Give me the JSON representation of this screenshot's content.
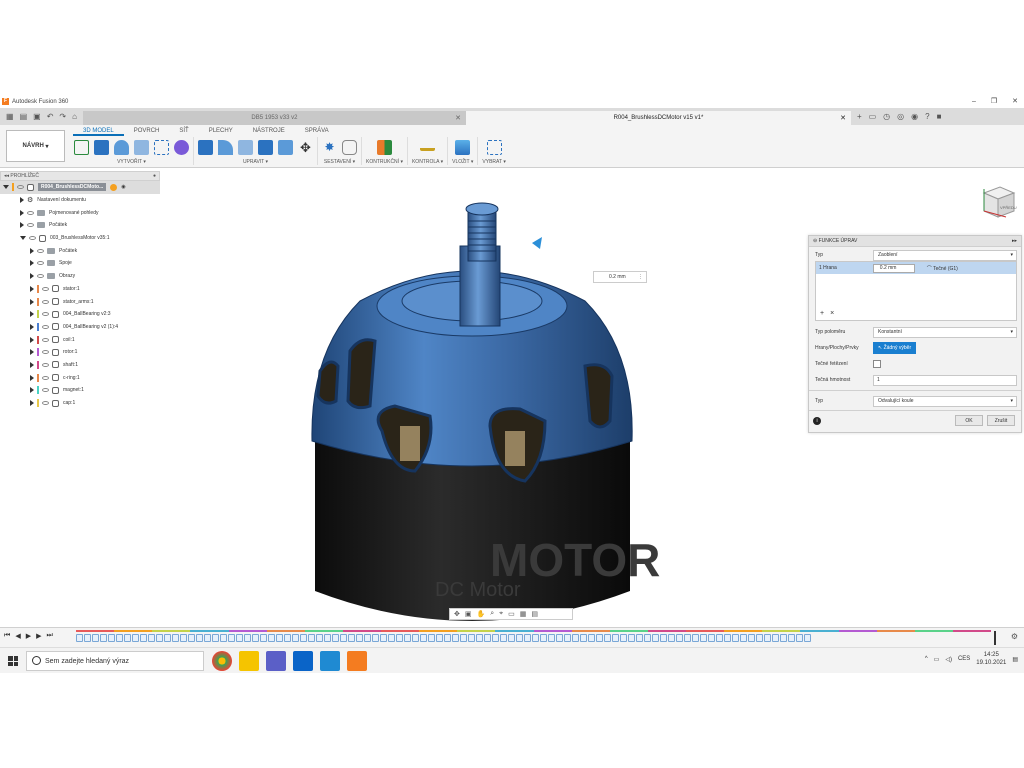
{
  "window": {
    "title": "Autodesk Fusion 360"
  },
  "tabs": [
    {
      "label": "DB5 1953 v33 v2",
      "active": false
    },
    {
      "label": "R004_BrushlessDCMotor v15 v1*",
      "active": true
    }
  ],
  "toolbar": {
    "nav_button": "NÁVRH",
    "workspace_tabs": [
      "3D MODEL",
      "POVRCH",
      "SÍŤ",
      "PLECHY",
      "NÁSTROJE",
      "SPRÁVA"
    ],
    "groups": [
      {
        "label": "VYTVOŘIT ▾"
      },
      {
        "label": "UPRAVIT ▾"
      },
      {
        "label": "SESTAVENÍ ▾"
      },
      {
        "label": "KONTRUKČNÍ ▾"
      },
      {
        "label": "KONTROLA ▾"
      },
      {
        "label": "VLOŽIT ▾"
      },
      {
        "label": "VYBRAT ▾"
      }
    ]
  },
  "browser": {
    "title": "PROHLÍŽEČ",
    "root": "R004_BrushlessDCMoto...",
    "items": [
      {
        "label": "Nastavení dokumentu",
        "level": 1,
        "icon": "gear-icon"
      },
      {
        "label": "Pojmenované pohledy",
        "level": 1,
        "icon": "folder-icon"
      },
      {
        "label": "Počátek",
        "level": 1,
        "icon": "folder-icon"
      },
      {
        "label": "003_BrushlessMotor v35:1",
        "level": 1,
        "icon": "component-icon",
        "expanded": true
      },
      {
        "label": "Počátek",
        "level": 2,
        "icon": "folder-icon"
      },
      {
        "label": "Spoje",
        "level": 2,
        "icon": "folder-icon"
      },
      {
        "label": "Obrazy",
        "level": 2,
        "icon": "folder-icon"
      },
      {
        "label": "stator:1",
        "level": 2,
        "icon": "component-icon",
        "color": "#e8884a"
      },
      {
        "label": "stator_arms:1",
        "level": 2,
        "icon": "component-icon",
        "color": "#e8884a"
      },
      {
        "label": "004_BallBearing v2:3",
        "level": 2,
        "icon": "component-icon",
        "color": "#c4d24a"
      },
      {
        "label": "004_BallBearing v2 (1):4",
        "level": 2,
        "icon": "component-icon",
        "color": "#4a7fd2"
      },
      {
        "label": "coil:1",
        "level": 2,
        "icon": "component-icon",
        "color": "#d24a4a"
      },
      {
        "label": "rotor:1",
        "level": 2,
        "icon": "component-icon",
        "color": "#b45ad2"
      },
      {
        "label": "shaft:1",
        "level": 2,
        "icon": "component-icon",
        "color": "#d24a8a"
      },
      {
        "label": "c-ring:1",
        "level": 2,
        "icon": "component-icon",
        "color": "#e8884a"
      },
      {
        "label": "magnet:1",
        "level": 2,
        "icon": "component-icon",
        "color": "#4ad2c4"
      },
      {
        "label": "cap:1",
        "level": 2,
        "icon": "component-icon",
        "color": "#e8c84a"
      }
    ]
  },
  "viewport": {
    "dimension_value": "0.2 mm",
    "viewcube_label": "VPŘEDU",
    "model_text_1": "MOTOR",
    "model_text_2": "DC Motor"
  },
  "fillet_panel": {
    "title": "FUNKCE ÚPRAV",
    "type_label": "Typ",
    "type_value": "Zaoblení",
    "edge_row_label": "1 Hrana",
    "edge_row_value": "0.2 mm",
    "edge_row_continuity": "Tečné (G1)",
    "add_btn": "+",
    "remove_btn": "×",
    "radius_type_label": "Typ poloměru",
    "radius_type_value": "Konstantní",
    "selection_label": "Hrany/Plochy/Prvky",
    "selection_value": "Žádný výběr",
    "tangent_chain_label": "Tečné řetězení",
    "tangent_weight_label": "Tečná hmotnost",
    "tangent_weight_value": "1",
    "corner_type_label": "Typ",
    "corner_type_value": "Odvalující koule",
    "ok": "OK",
    "cancel": "Zrušit"
  },
  "taskbar": {
    "search_placeholder": "Sem zadejte hledaný výraz",
    "language": "CES",
    "time": "14:25",
    "date": "19.10.2021"
  },
  "colors": {
    "accent": "#0a6fb8",
    "motor_blue": "#3f6fa8",
    "selection_blue": "#1a7fd0"
  }
}
